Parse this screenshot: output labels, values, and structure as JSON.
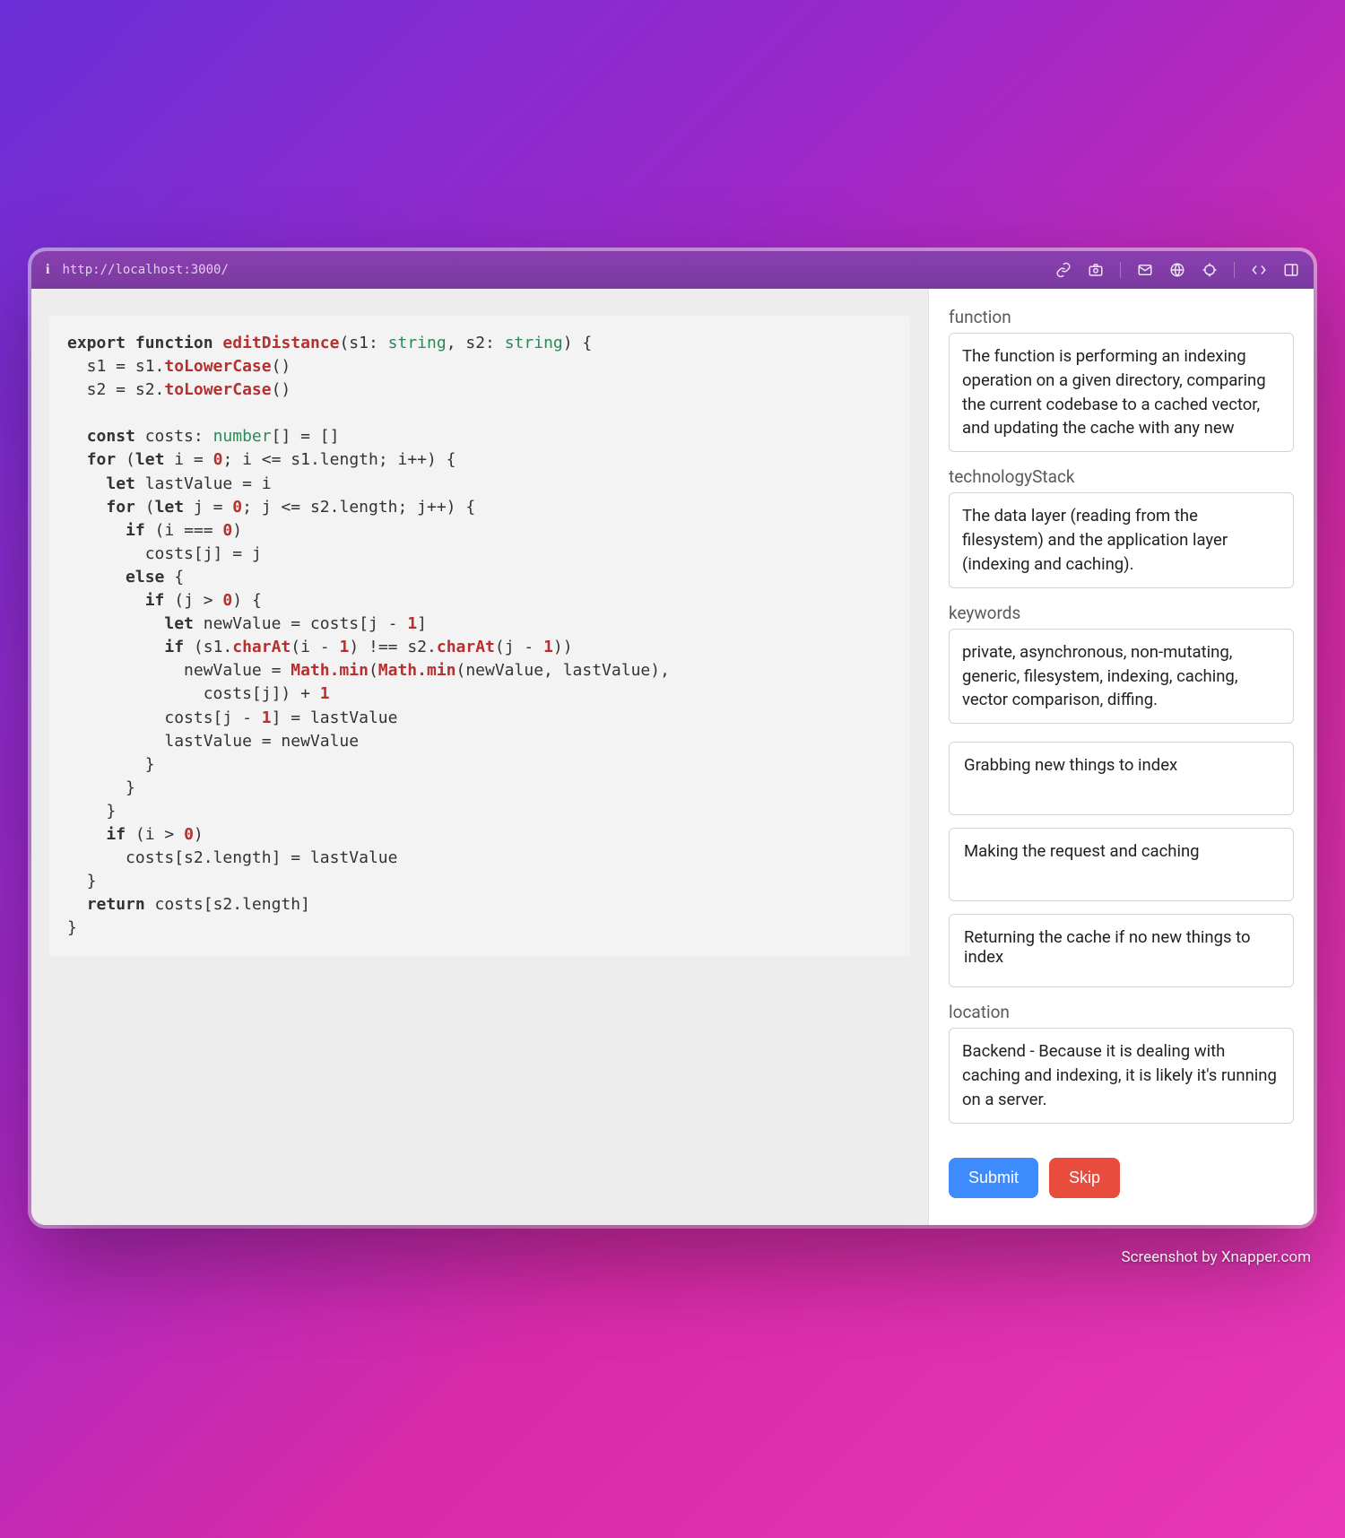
{
  "browser": {
    "url": "http://localhost:3000/"
  },
  "code": {
    "lines_html": "<span class=\"kw\">export</span> <span class=\"kw\">function</span> <span class=\"fnred\">editDistance</span>(s1: <span class=\"type\">string</span>, s2: <span class=\"type\">string</span>) {\n  s1 = s1.<span class=\"prop\">toLowerCase</span>()\n  s2 = s2.<span class=\"prop\">toLowerCase</span>()\n\n  <span class=\"kw\">const</span> costs: <span class=\"type\">number</span>[] = []\n  <span class=\"kw\">for</span> (<span class=\"kw\">let</span> i = <span class=\"num\">0</span>; i <= s1.length; i++) {\n    <span class=\"kw\">let</span> lastValue = i\n    <span class=\"kw\">for</span> (<span class=\"kw\">let</span> j = <span class=\"num\">0</span>; j <= s2.length; j++) {\n      <span class=\"kw\">if</span> (i === <span class=\"num\">0</span>)\n        costs[j] = j\n      <span class=\"kw\">else</span> {\n        <span class=\"kw\">if</span> (j > <span class=\"num\">0</span>) {\n          <span class=\"kw\">let</span> newValue = costs[j - <span class=\"num\">1</span>]\n          <span class=\"kw\">if</span> (s1.<span class=\"prop\">charAt</span>(i - <span class=\"num\">1</span>) !== s2.<span class=\"prop\">charAt</span>(j - <span class=\"num\">1</span>))\n            newValue = <span class=\"prop\">Math.min</span>(<span class=\"prop\">Math.min</span>(newValue, lastValue),\n              costs[j]) + <span class=\"num\">1</span>\n          costs[j - <span class=\"num\">1</span>] = lastValue\n          lastValue = newValue\n        }\n      }\n    }\n    <span class=\"kw\">if</span> (i > <span class=\"num\">0</span>)\n      costs[s2.length] = lastValue\n  }\n  <span class=\"kw\">return</span> costs[s2.length]\n}"
  },
  "form": {
    "function": {
      "label": "function",
      "value": "The function is performing an indexing operation on a given directory, comparing the current codebase to a cached vector, and updating the cache with any new"
    },
    "technologyStack": {
      "label": "technologyStack",
      "value": "The data layer (reading from the filesystem) and the application layer (indexing and caching)."
    },
    "keywords": {
      "label": "keywords",
      "value": "private, asynchronous, non-mutating, generic, filesystem, indexing, caching, vector comparison, diffing."
    },
    "notes": [
      "Grabbing new things to index",
      "Making the request and caching",
      "Returning the cache if no new things to index"
    ],
    "location": {
      "label": "location",
      "value": "Backend - Because it is dealing with caching and indexing, it is likely it's running on a server."
    },
    "submitLabel": "Submit",
    "skipLabel": "Skip"
  },
  "watermark": "Screenshot by Xnapper.com"
}
